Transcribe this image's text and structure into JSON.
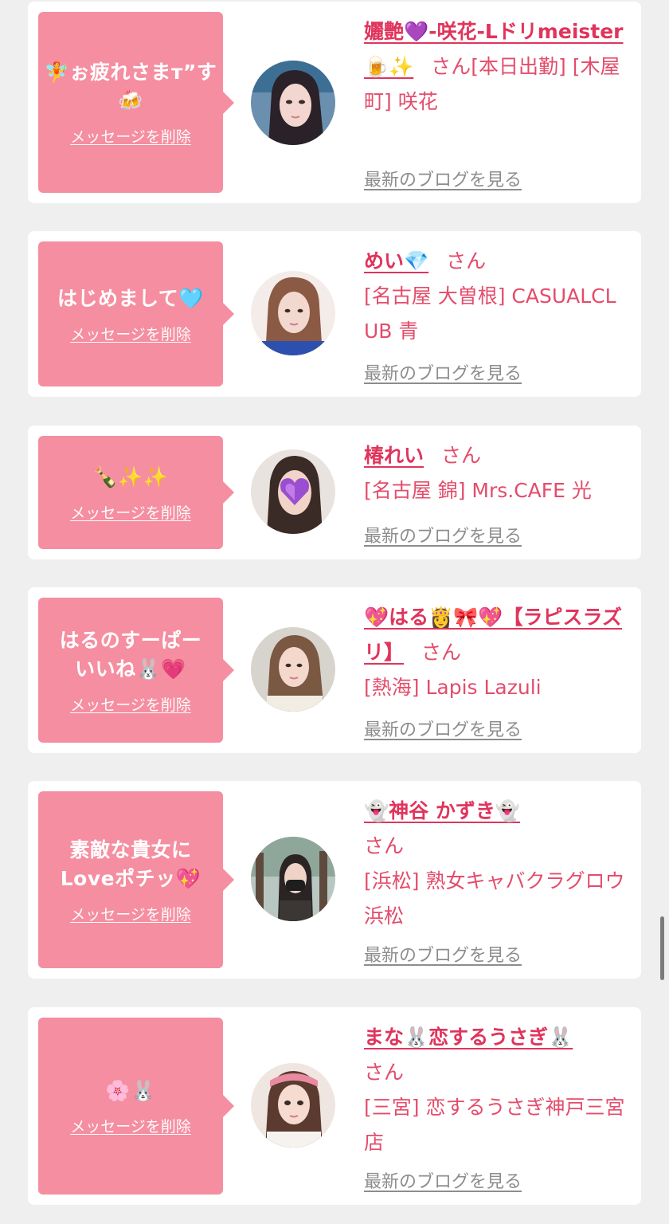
{
  "ui": {
    "delete_label": "メッセージを削除",
    "blog_label": "最新のブログを見る"
  },
  "colors": {
    "page_bg": "#efefef",
    "bubble": "#f58ea0",
    "name": "#e0345c",
    "text": "#e44c6b",
    "blog_link": "#8d8d8d"
  },
  "messages": [
    {
      "message": "🧚ぉ疲れさまт”す🍻",
      "name": "孋艶💜-咲花-Lドリmeister🍺✨",
      "suffix": "さん",
      "shop": "[本日出勤] [木屋町] 咲花"
    },
    {
      "message": "はじめまして🩵",
      "name": "めい💎",
      "suffix": "さん",
      "shop": "[名古屋 大曽根] CASUALCLUB 青"
    },
    {
      "message": "🍾✨✨",
      "name": "椿れい",
      "suffix": "さん",
      "shop": "[名古屋 錦] Mrs.CAFE 光"
    },
    {
      "message": "はるのすーぱーいいね🐰💗",
      "name": "💖はる👸🎀💖【ラピスラズリ】",
      "suffix": "さん",
      "shop": "[熱海] Lapis Lazuli"
    },
    {
      "message": "素敵な貴女にLoveポチッ💖",
      "name": "👻神谷 かずき👻",
      "suffix": "さん",
      "shop": "[浜松] 熟女キャバクラグロウ 浜松"
    },
    {
      "message": "🌸🐰",
      "name": "まな🐰恋するうさぎ🐰",
      "suffix": "さん",
      "shop": "[三宮] 恋するうさぎ神戸三宮店"
    }
  ]
}
